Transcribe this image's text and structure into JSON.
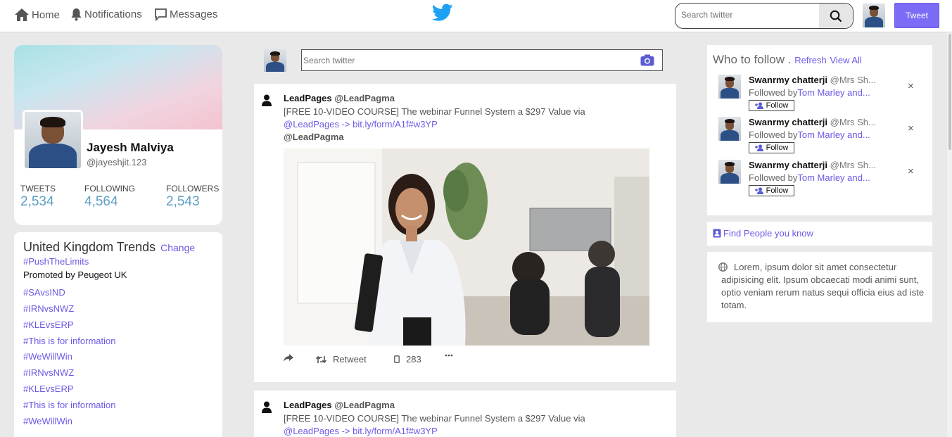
{
  "nav": {
    "home": "Home",
    "notifications": "Notifications",
    "messages": "Messages",
    "search_placeholder": "Search twitter",
    "tweet_button": "Tweet"
  },
  "profile": {
    "name": "Jayesh Malviya",
    "handle": "@jayeshjit.123",
    "stats": [
      {
        "label": "TWEETS",
        "value": "2,534"
      },
      {
        "label": "FOLLOWING",
        "value": "4,564"
      },
      {
        "label": "FOLLOWERS",
        "value": "2,543"
      }
    ]
  },
  "trends": {
    "title": "United Kingdom Trends",
    "change": "Change",
    "promoted_tag": "#PushTheLimits",
    "promoted_by": "Promoted by Peugeot UK",
    "items": [
      "#SAvsIND",
      "#IRNvsNWZ",
      "#KLEvsERP",
      "#This is for information",
      "#WeWillWin",
      "#IRNvsNWZ",
      "#KLEvsERP",
      "#This is for information",
      "#WeWillWin"
    ]
  },
  "compose": {
    "placeholder": "Search twitter"
  },
  "tweets": [
    {
      "name": "LeadPages",
      "handle": "@LeadPagma",
      "text": "[FREE 10-VIDEO COURSE] The webinar Funnel System a $297 Value via",
      "link": "@LeadPages -> bit.ly/form/A1f#w3YP",
      "mention": "@LeadPagma",
      "retweet_label": "Retweet",
      "count": "283"
    },
    {
      "name": "LeadPages",
      "handle": "@LeadPagma",
      "text": "[FREE 10-VIDEO COURSE] The webinar Funnel System a $297 Value via",
      "link": "@LeadPages -> bit.ly/form/A1f#w3YP"
    }
  ],
  "who_to_follow": {
    "title": "Who to follow .",
    "refresh": "Refresh",
    "view_all": "View All",
    "follow_label": "Follow",
    "close": "×",
    "suggestions": [
      {
        "name": "Swanrmy chatterji",
        "handle": "@Mrs Sh...",
        "followed_prefix": "Followed by",
        "followed_by": "Tom Marley and..."
      },
      {
        "name": "Swanrmy chatterji",
        "handle": "@Mrs Sh...",
        "followed_prefix": "Followed by",
        "followed_by": "Tom Marley and..."
      },
      {
        "name": "Swanrmy chatterji",
        "handle": "@Mrs Sh...",
        "followed_prefix": "Followed by",
        "followed_by": "Tom Marley and..."
      }
    ]
  },
  "find_people": "Find People you know",
  "about_text": "Lorem, ipsum dolor sit amet consectetur adipisicing elit. Ipsum obcaecati modi animi sunt, optio veniam rerum natus sequi officia eius ad iste totam.",
  "colors": {
    "accent": "#7c6cf5",
    "link": "#6a5ae6",
    "stat_value": "#5e9fc4",
    "twitter_blue": "#1da1f2"
  }
}
